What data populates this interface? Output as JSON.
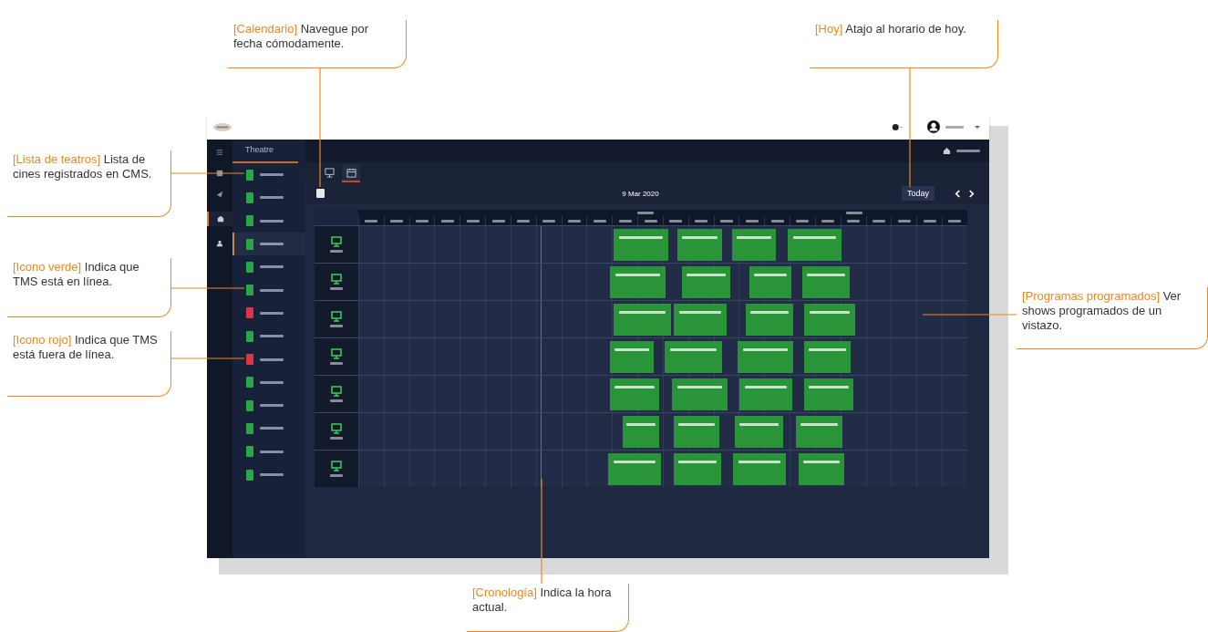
{
  "callouts": [
    {
      "kind": "calendar",
      "tag": "[Calendario]",
      "text": "Navegue por fecha cómodamente."
    },
    {
      "kind": "today",
      "tag": "[Hoy]",
      "text": "Atajo al horario de hoy."
    },
    {
      "kind": "theatres",
      "tag": "[Lista de teatros]",
      "text": "Lista de cines registrados en CMS."
    },
    {
      "kind": "green",
      "tag": "[Icono verde]",
      "text": "Indica que TMS está en línea."
    },
    {
      "kind": "red",
      "tag": "[Icono rojo]",
      "text": "Indica que TMS está fuera de línea."
    },
    {
      "kind": "shows",
      "tag": "[Programas programados]",
      "text": "Ver shows programados de un vistazo."
    },
    {
      "kind": "timeline",
      "tag": "[Cronología]",
      "text": "Indica la hora actual."
    }
  ],
  "app": {
    "panel_title": "Theatre",
    "view_tabs": [
      {
        "kind": "screens",
        "selected": false
      },
      {
        "kind": "calendar",
        "selected": true
      }
    ],
    "date": "9 Mar 2020",
    "today_button": "Today",
    "theatres": [
      {
        "online": true,
        "selected": false
      },
      {
        "online": true,
        "selected": false
      },
      {
        "online": true,
        "selected": false
      },
      {
        "online": true,
        "selected": true
      },
      {
        "online": true,
        "selected": false
      },
      {
        "online": true,
        "selected": false
      },
      {
        "online": false,
        "selected": false
      },
      {
        "online": true,
        "selected": false
      },
      {
        "online": false,
        "selected": false
      },
      {
        "online": true,
        "selected": false
      },
      {
        "online": true,
        "selected": false
      },
      {
        "online": true,
        "selected": false
      },
      {
        "online": true,
        "selected": false
      },
      {
        "online": true,
        "selected": false
      }
    ],
    "screens": [
      {
        "online": true,
        "shows": [
          {
            "kind": "show"
          },
          {
            "kind": "show"
          },
          {
            "kind": "show"
          },
          {
            "kind": "show"
          }
        ]
      },
      {
        "online": true,
        "shows": [
          {
            "kind": "show"
          },
          {
            "kind": "show"
          },
          {
            "kind": "show"
          },
          {
            "kind": "show"
          }
        ]
      },
      {
        "online": true,
        "shows": [
          {
            "kind": "show"
          },
          {
            "kind": "show"
          },
          {
            "kind": "show"
          },
          {
            "kind": "show"
          }
        ]
      },
      {
        "online": true,
        "shows": [
          {
            "kind": "show"
          },
          {
            "kind": "show"
          },
          {
            "kind": "show"
          },
          {
            "kind": "show"
          }
        ]
      },
      {
        "online": true,
        "shows": [
          {
            "kind": "show"
          },
          {
            "kind": "show"
          },
          {
            "kind": "show"
          },
          {
            "kind": "show"
          }
        ]
      },
      {
        "online": true,
        "shows": [
          {
            "kind": "show"
          },
          {
            "kind": "show"
          },
          {
            "kind": "show"
          },
          {
            "kind": "show"
          }
        ]
      },
      {
        "online": true,
        "shows": [
          {
            "kind": "show"
          },
          {
            "kind": "show"
          },
          {
            "kind": "show"
          },
          {
            "kind": "show"
          }
        ]
      }
    ]
  }
}
